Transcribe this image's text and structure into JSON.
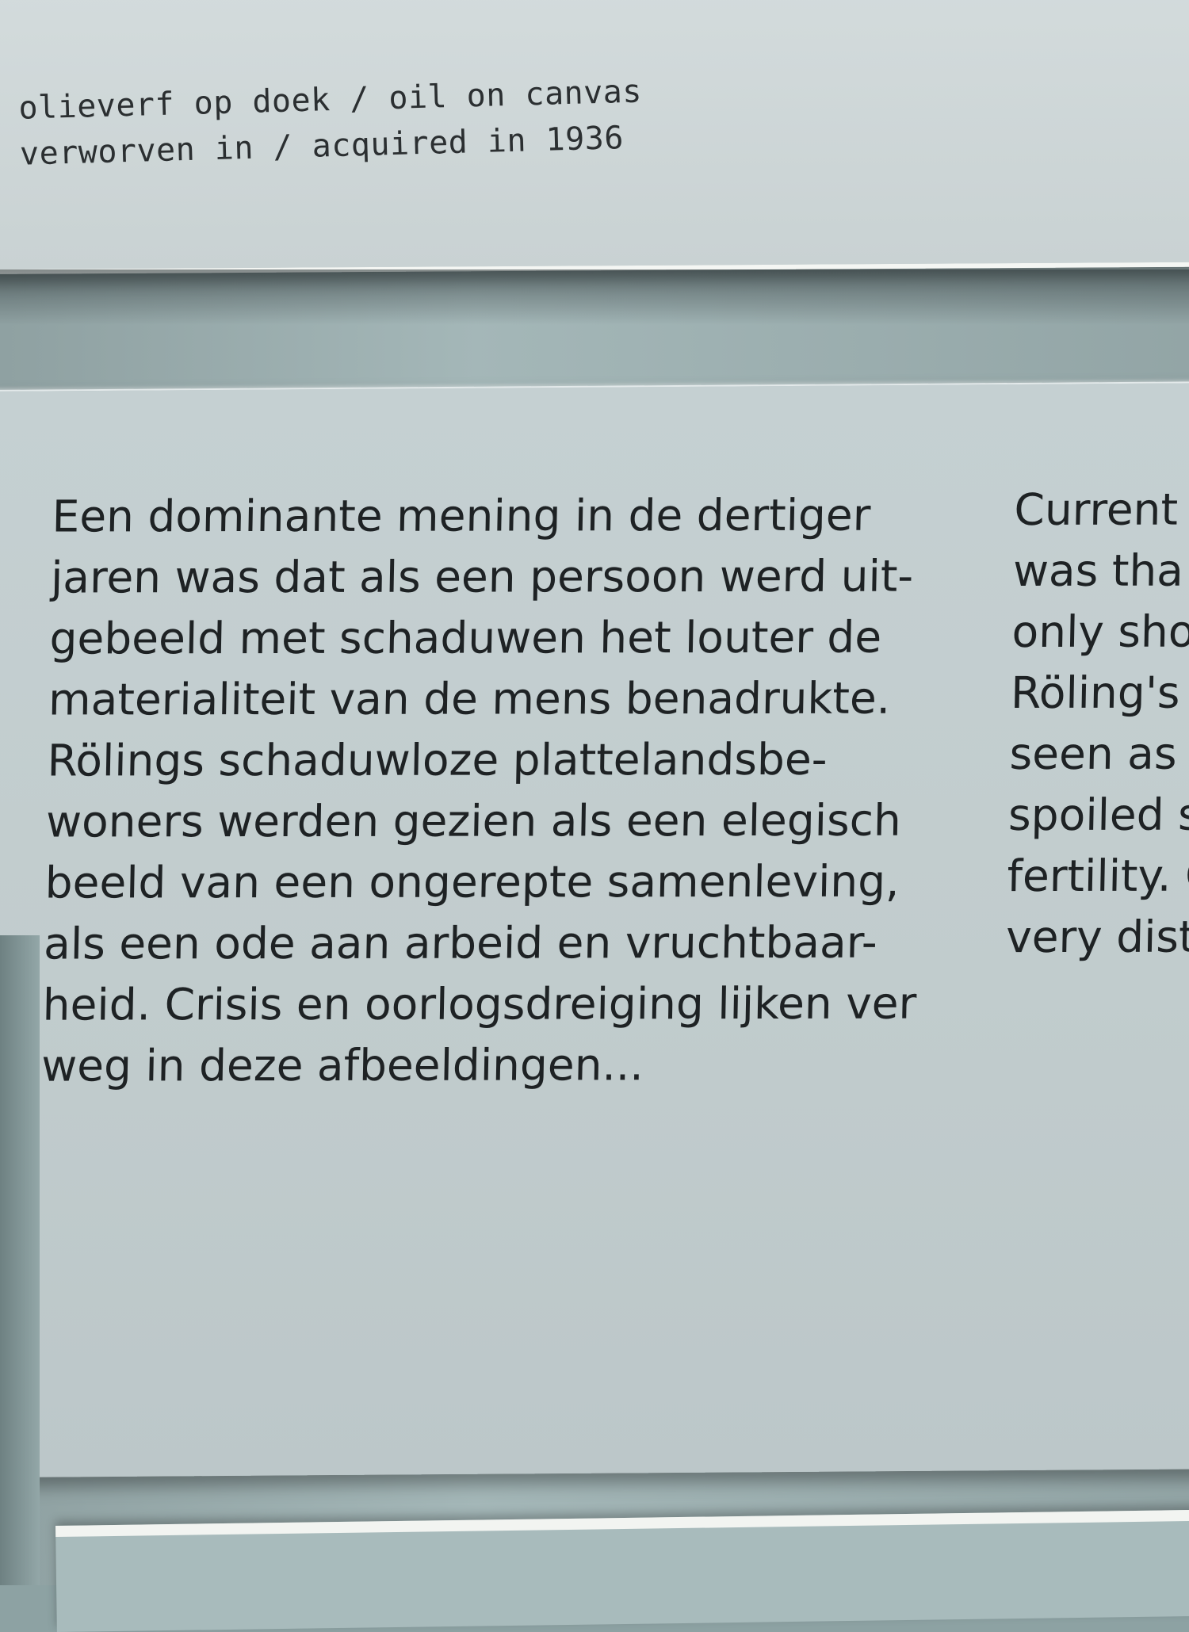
{
  "top_label": {
    "lines": [
      "olieverf op doek / oil on canvas",
      "verworven in / acquired in 1936"
    ]
  },
  "main_text": {
    "dutch_lines": [
      "Een dominante mening in de dertiger",
      "jaren was dat als een persoon werd uit-",
      "gebeeld met schaduwen het louter de",
      "materialiteit van de mens benadrukte.",
      "Rölings schaduwloze plattelandsbe-",
      "woners werden gezien als een elegisch",
      "beeld van een ongerepte samenleving,",
      "als een ode aan arbeid en vruchtbaar-",
      "heid. Crisis en oorlogsdreiging lijken ver",
      "weg in deze afbeeldingen..."
    ],
    "english_lines": [
      "Current",
      "was tha",
      "only sho",
      "Röling's",
      "seen as",
      "spoiled s",
      "fertility. C",
      "very dista"
    ]
  }
}
